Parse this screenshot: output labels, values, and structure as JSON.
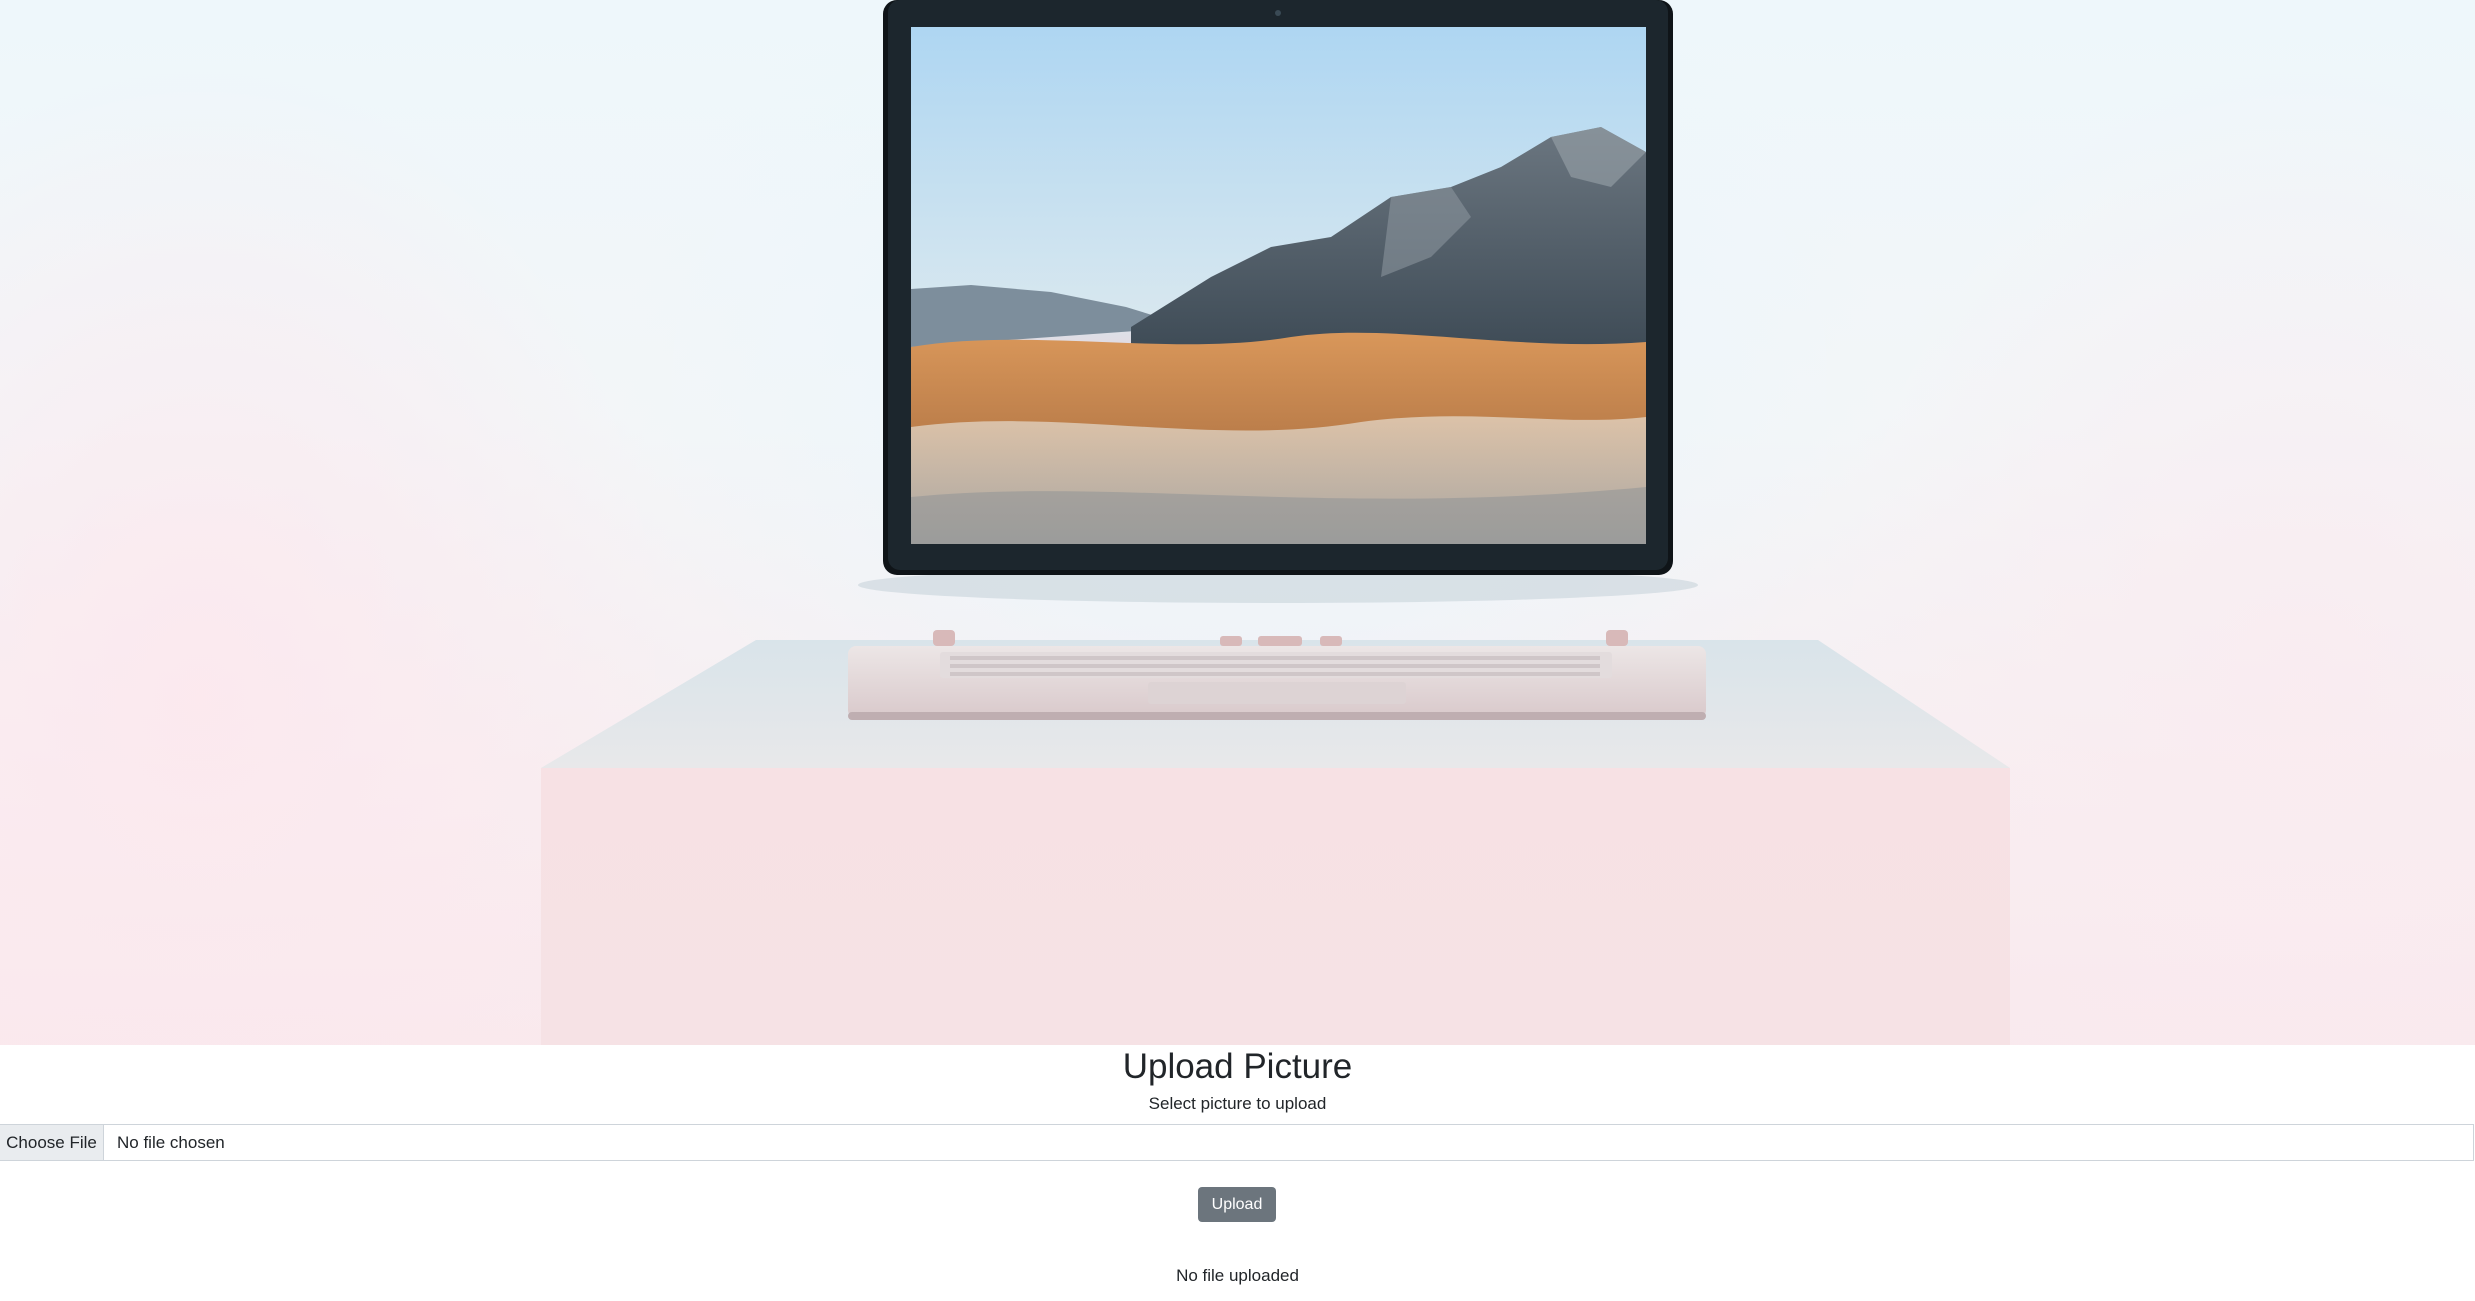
{
  "page": {
    "title": "Upload Picture",
    "subtitle": "Select picture to upload"
  },
  "hero": {
    "icon": "laptop-hero-image",
    "colors": {
      "sky_top": "#aed6f1",
      "mountain": "#5a6570",
      "dune": "#c98b52",
      "pedestal": "#f5e4e7"
    }
  },
  "form": {
    "choose_label": "Choose File",
    "file_status": "No file chosen",
    "upload_label": "Upload"
  },
  "result": {
    "status": "No file uploaded"
  },
  "colors": {
    "button_secondary": "#6c757d",
    "choose_bg": "#e9ecef",
    "border": "#ced4da",
    "text": "#212529"
  }
}
